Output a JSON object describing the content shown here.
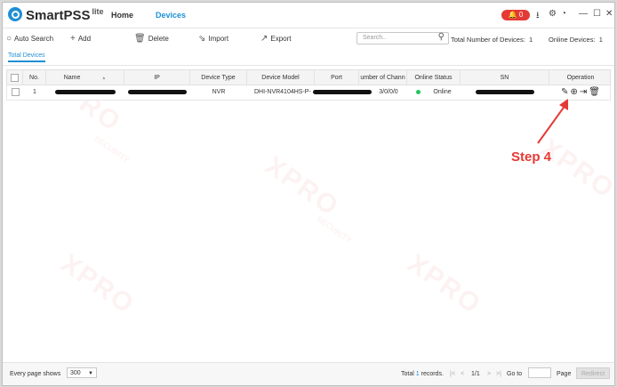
{
  "app": {
    "name": "SmartPSS",
    "suffix": "lite"
  },
  "nav": {
    "home": "Home",
    "devices": "Devices"
  },
  "titlebar": {
    "alarm_count": "0"
  },
  "toolbar": {
    "auto_search": "Auto Search",
    "add": "Add",
    "delete": "Delete",
    "import": "Import",
    "export": "Export",
    "search_placeholder": "Search..",
    "total_devices_label": "Total Number of Devices:",
    "total_devices_value": "1",
    "online_devices_label": "Online Devices:",
    "online_devices_value": "1"
  },
  "tabs": {
    "total_devices": "Total Devices"
  },
  "table": {
    "headers": {
      "no": "No.",
      "name": "Name",
      "sort": "▲",
      "ip": "IP",
      "device_type": "Device Type",
      "device_model": "Device Model",
      "port": "Port",
      "channels": "umber of Chann",
      "online_status": "Online Status",
      "sn": "SN",
      "operation": "Operation"
    },
    "rows": [
      {
        "no": "1",
        "device_type": "NVR",
        "device_model": "DHI-NVR4104HS-P-",
        "channels": "3/0/0/0",
        "online_status": "Online"
      }
    ]
  },
  "annotation": {
    "step": "Step 4"
  },
  "watermark": {
    "text": "XPRO",
    "sub": "SECURITY"
  },
  "footer": {
    "every_page_shows": "Every page shows",
    "page_size": "300",
    "total_prefix": "Total",
    "total_records": "1",
    "records_suffix": "records.",
    "page_indicator": "1/1",
    "goto": "Go to",
    "page": "Page",
    "redirect": "Redirect"
  },
  "colors": {
    "accent": "#1e8fd6",
    "alarm": "#e53935",
    "online": "#22c55e",
    "annotation": "#e53935"
  },
  "icons": [
    "search-icon",
    "add-icon",
    "delete-icon",
    "import-icon",
    "export-icon",
    "edit-icon",
    "web-icon",
    "logout-icon",
    "trash-icon"
  ]
}
